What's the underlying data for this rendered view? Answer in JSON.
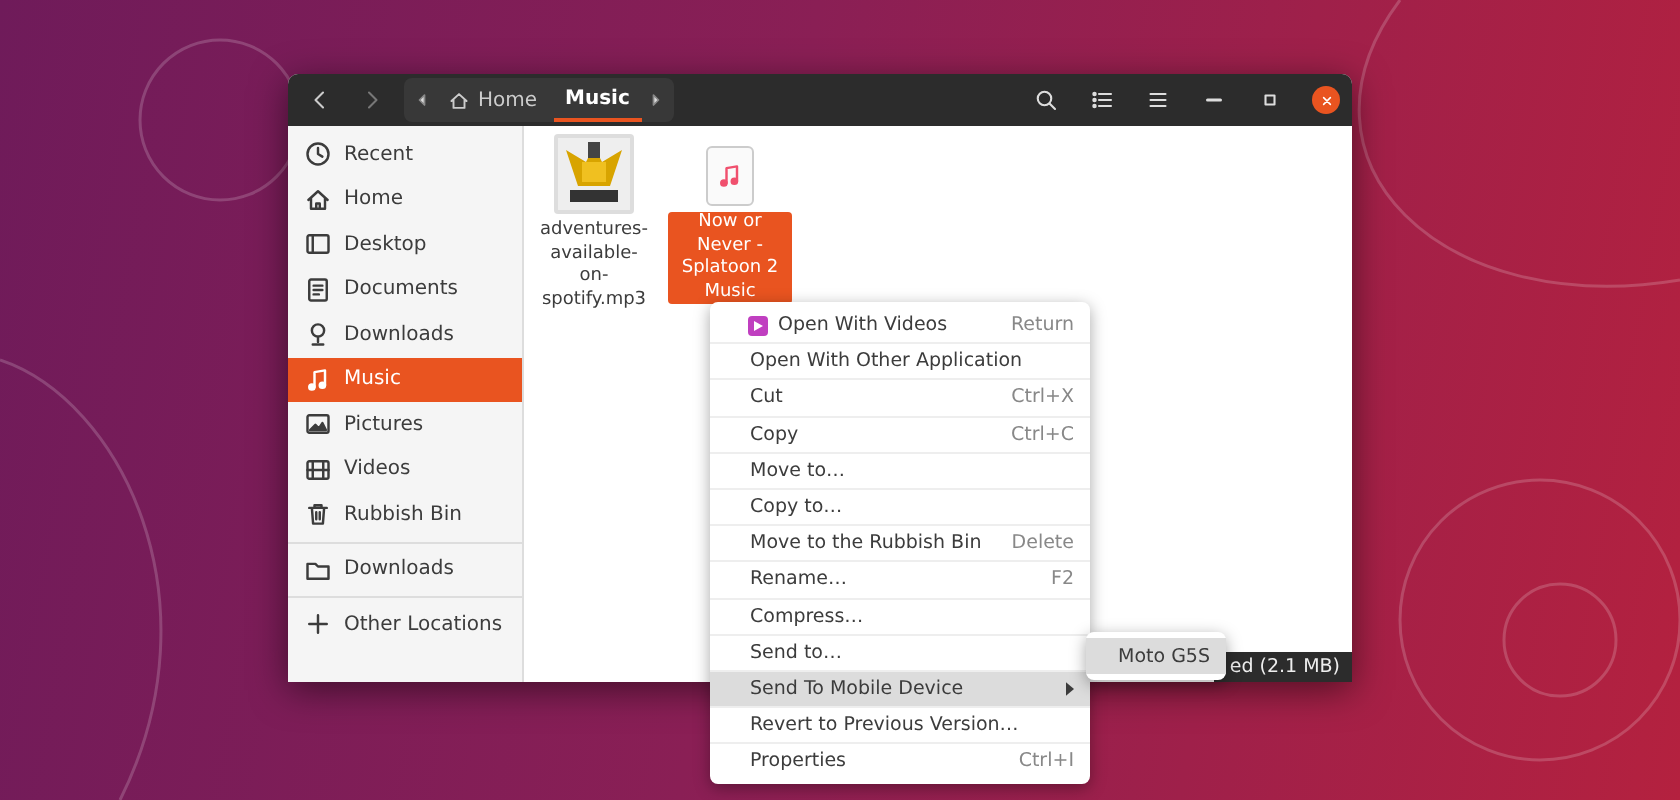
{
  "header": {
    "path": [
      {
        "label": "Home",
        "kind": "home",
        "selected": false
      },
      {
        "label": "Music",
        "kind": "folder",
        "selected": true
      }
    ]
  },
  "sidebar": {
    "items": [
      {
        "label": "Recent",
        "kind": "recent",
        "selected": false
      },
      {
        "label": "Home",
        "kind": "home",
        "selected": false
      },
      {
        "label": "Desktop",
        "kind": "desktop",
        "selected": false
      },
      {
        "label": "Documents",
        "kind": "documents",
        "selected": false
      },
      {
        "label": "Downloads",
        "kind": "downloads",
        "selected": false
      },
      {
        "label": "Music",
        "kind": "music",
        "selected": true
      },
      {
        "label": "Pictures",
        "kind": "pictures",
        "selected": false
      },
      {
        "label": "Videos",
        "kind": "videos",
        "selected": false
      },
      {
        "label": "Rubbish Bin",
        "kind": "bin",
        "selected": false
      }
    ],
    "devices": [
      {
        "label": "Downloads",
        "kind": "drive",
        "selected": false
      }
    ],
    "other": {
      "label": "Other Locations"
    }
  },
  "files": [
    {
      "name": "adventures-available-on-spotify.mp3",
      "kind": "picture",
      "selected": false
    },
    {
      "name": "Now or Never - Splatoon 2 Music",
      "kind": "audio",
      "selected": true
    }
  ],
  "status_bar": {
    "text": "ed (2.1 MB)"
  },
  "context_menu": {
    "items": [
      {
        "label": "Open With Videos",
        "shortcut": "Return",
        "kind": "app",
        "selected": false,
        "submenu": false
      },
      {
        "label": "Open With Other Application",
        "selected": false,
        "submenu": false
      },
      {
        "label": "Cut",
        "shortcut": "Ctrl+X",
        "selected": false,
        "submenu": false
      },
      {
        "label": "Copy",
        "shortcut": "Ctrl+C",
        "selected": false,
        "submenu": false
      },
      {
        "label": "Move to…",
        "selected": false,
        "submenu": false
      },
      {
        "label": "Copy to…",
        "selected": false,
        "submenu": false
      },
      {
        "label": "Move to the Rubbish Bin",
        "shortcut": "Delete",
        "selected": false,
        "submenu": false
      },
      {
        "label": "Rename…",
        "shortcut": "F2",
        "selected": false,
        "submenu": false
      },
      {
        "label": "Compress…",
        "selected": false,
        "submenu": false
      },
      {
        "label": "Send to…",
        "selected": false,
        "submenu": false
      },
      {
        "label": "Send To Mobile Device",
        "selected": true,
        "submenu": true
      },
      {
        "label": "Revert to Previous Version…",
        "selected": false,
        "submenu": false
      },
      {
        "label": "Properties",
        "shortcut": "Ctrl+I",
        "selected": false,
        "submenu": false
      }
    ]
  },
  "submenu": {
    "items": [
      {
        "label": "Moto G5S",
        "selected": true
      }
    ]
  }
}
